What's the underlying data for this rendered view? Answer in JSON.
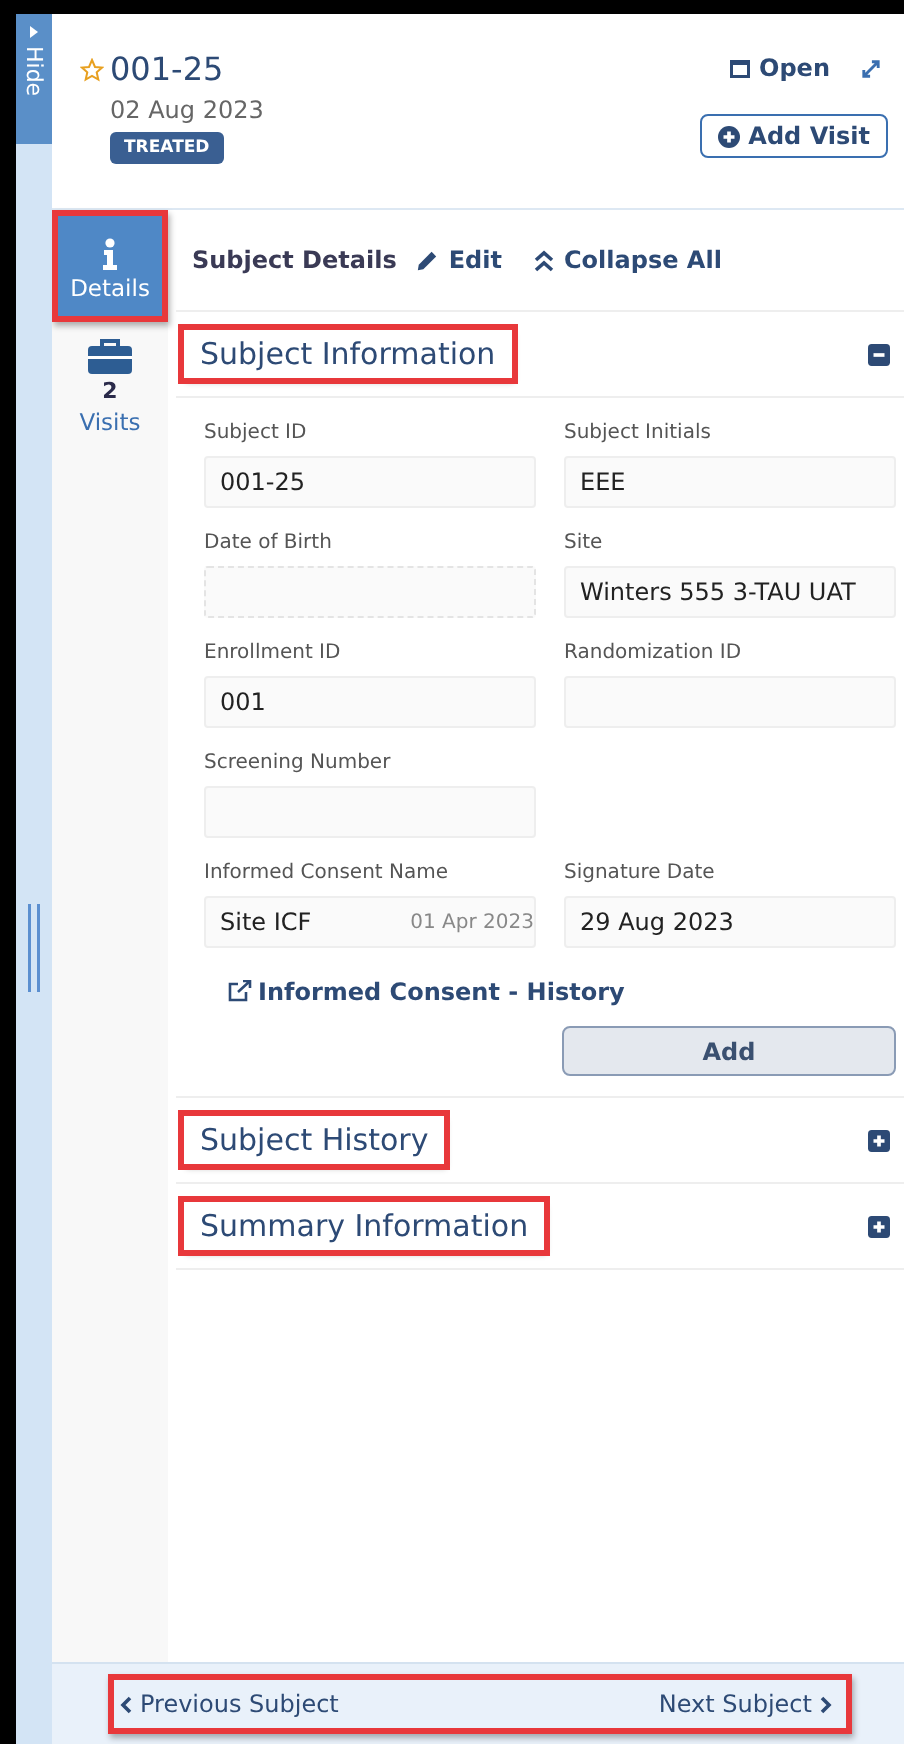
{
  "side_tab": {
    "label": "Hide"
  },
  "header": {
    "starred": false,
    "subject_id": "001-25",
    "date": "02 Aug 2023",
    "status": "TREATED",
    "open_label": "Open",
    "add_visit_label": "Add Visit"
  },
  "nav": [
    {
      "kind": "details",
      "label": "Details",
      "selected": true,
      "highlighted": true
    },
    {
      "kind": "visits",
      "count": "2",
      "label": "Visits",
      "selected": false,
      "highlighted": false
    }
  ],
  "toolbar": {
    "title": "Subject Details",
    "edit_label": "Edit",
    "collapse_label": "Collapse All"
  },
  "sections": [
    {
      "title": "Subject Information",
      "expanded": true,
      "highlighted": true,
      "rows": [
        {
          "fields": [
            {
              "kind": "text",
              "label": "Subject ID",
              "value": "001-25"
            },
            {
              "kind": "text",
              "label": "Subject Initials",
              "value": "EEE"
            }
          ]
        },
        {
          "fields": [
            {
              "kind": "date",
              "label": "Date of Birth"
            },
            {
              "kind": "text",
              "label": "Site",
              "value": "Winters 555 3-TAU UAT"
            }
          ]
        },
        {
          "fields": [
            {
              "kind": "text",
              "label": "Enrollment ID",
              "value": "001"
            },
            {
              "kind": "text",
              "label": "Randomization ID"
            }
          ]
        },
        {
          "fields": [
            {
              "kind": "text",
              "label": "Screening Number"
            }
          ]
        },
        {
          "fields": [
            {
              "kind": "consent",
              "label": "Informed Consent Name",
              "value": "Site ICF",
              "secondary": "01 Apr 2023"
            },
            {
              "kind": "text",
              "label": "Signature Date",
              "value": "29 Aug 2023"
            }
          ]
        }
      ],
      "history_link": "Informed Consent - History",
      "add_label": "Add"
    },
    {
      "title": "Subject History",
      "expanded": false,
      "highlighted": true
    },
    {
      "title": "Summary Information",
      "expanded": false,
      "highlighted": true
    }
  ],
  "footer": {
    "highlighted": true,
    "previous_label": "Previous Subject",
    "next_label": "Next Subject"
  }
}
